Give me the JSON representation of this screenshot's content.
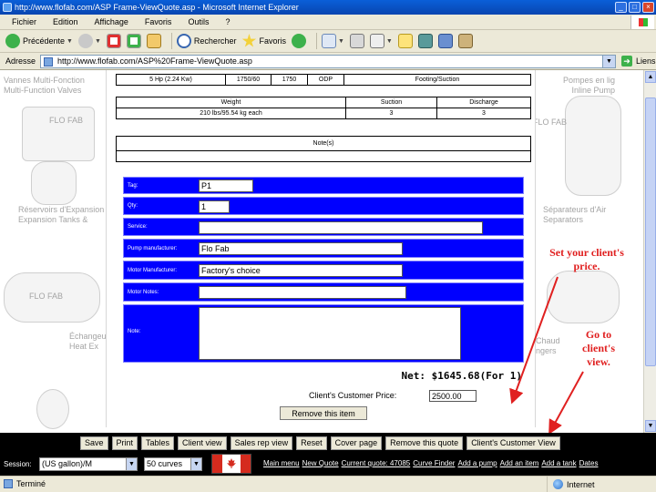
{
  "window": {
    "title": "http://www.flofab.com/ASP Frame-ViewQuote.asp - Microsoft Internet Explorer",
    "controls": [
      "_",
      "□",
      "×"
    ]
  },
  "menu": [
    "Fichier",
    "Edition",
    "Affichage",
    "Favoris",
    "Outils",
    "?"
  ],
  "toolbar": {
    "back": "Précédente",
    "search": "Rechercher",
    "favorites": "Favoris"
  },
  "address": {
    "label": "Adresse",
    "url": "http://www.flofab.com/ASP%20Frame-ViewQuote.asp",
    "links": "Liens"
  },
  "background": {
    "left_top": [
      "Vannes Multi-Fonction",
      "Multi-Function Valves"
    ],
    "left_mid": [
      "Réservoirs d'Expansion",
      "Expansion Tanks &"
    ],
    "left_low": [
      "Échangeurs",
      "Heat Ex"
    ],
    "right_top": [
      "Pompes en lig",
      "Inline Pump"
    ],
    "right_mid": [
      "Séparateurs d'Air",
      "Separators"
    ],
    "right_low": [
      "Chaud",
      "ngers"
    ],
    "logo": "FLO FAB"
  },
  "spec_table": {
    "row1": [
      "5 Hp (2.24 Kw)",
      "1750/60",
      "1750",
      "ODP",
      "Footing/Suction"
    ],
    "headers": [
      "Weight",
      "Suction",
      "Discharge"
    ],
    "values": [
      "210 lbs/95.54 kg each",
      "3",
      "3"
    ],
    "notes_header": "Note(s)"
  },
  "form": {
    "rows": [
      {
        "label": "Tag:",
        "value": "P1"
      },
      {
        "label": "Qty:",
        "value": "1"
      },
      {
        "label": "Service:",
        "value": ""
      },
      {
        "label": "Pump manufacturer:",
        "value": "Flo Fab"
      },
      {
        "label": "Motor Manufacturer:",
        "value": "Factory's choice"
      },
      {
        "label": "Motor Notes:",
        "value": ""
      },
      {
        "label": "Note:",
        "value": ""
      }
    ],
    "net_text": "Net: $1645.68(For 1)",
    "client_price_label": "Client's Customer Price:",
    "client_price_value": "2500.00",
    "remove_button": "Remove this item"
  },
  "annotations": {
    "set_price": "Set your client's price.",
    "go_to_view": "Go to client's view.",
    "color": "#e02020"
  },
  "actions": [
    "Save",
    "Print",
    "Tables",
    "Client view",
    "Sales rep view",
    "Reset",
    "Cover page",
    "Remove this quote",
    "Client's Customer View"
  ],
  "session": {
    "label": "Session:",
    "unit_select": "(US gallon)/M",
    "curve_select": "50 curves"
  },
  "nav_links": [
    "Main menu",
    "New Quote",
    "Current quote: 47085",
    "Curve Finder",
    "Add a pump",
    "Add an item",
    "Add a tank",
    "Dates"
  ],
  "status": {
    "left": "Terminé",
    "right": "Internet"
  }
}
